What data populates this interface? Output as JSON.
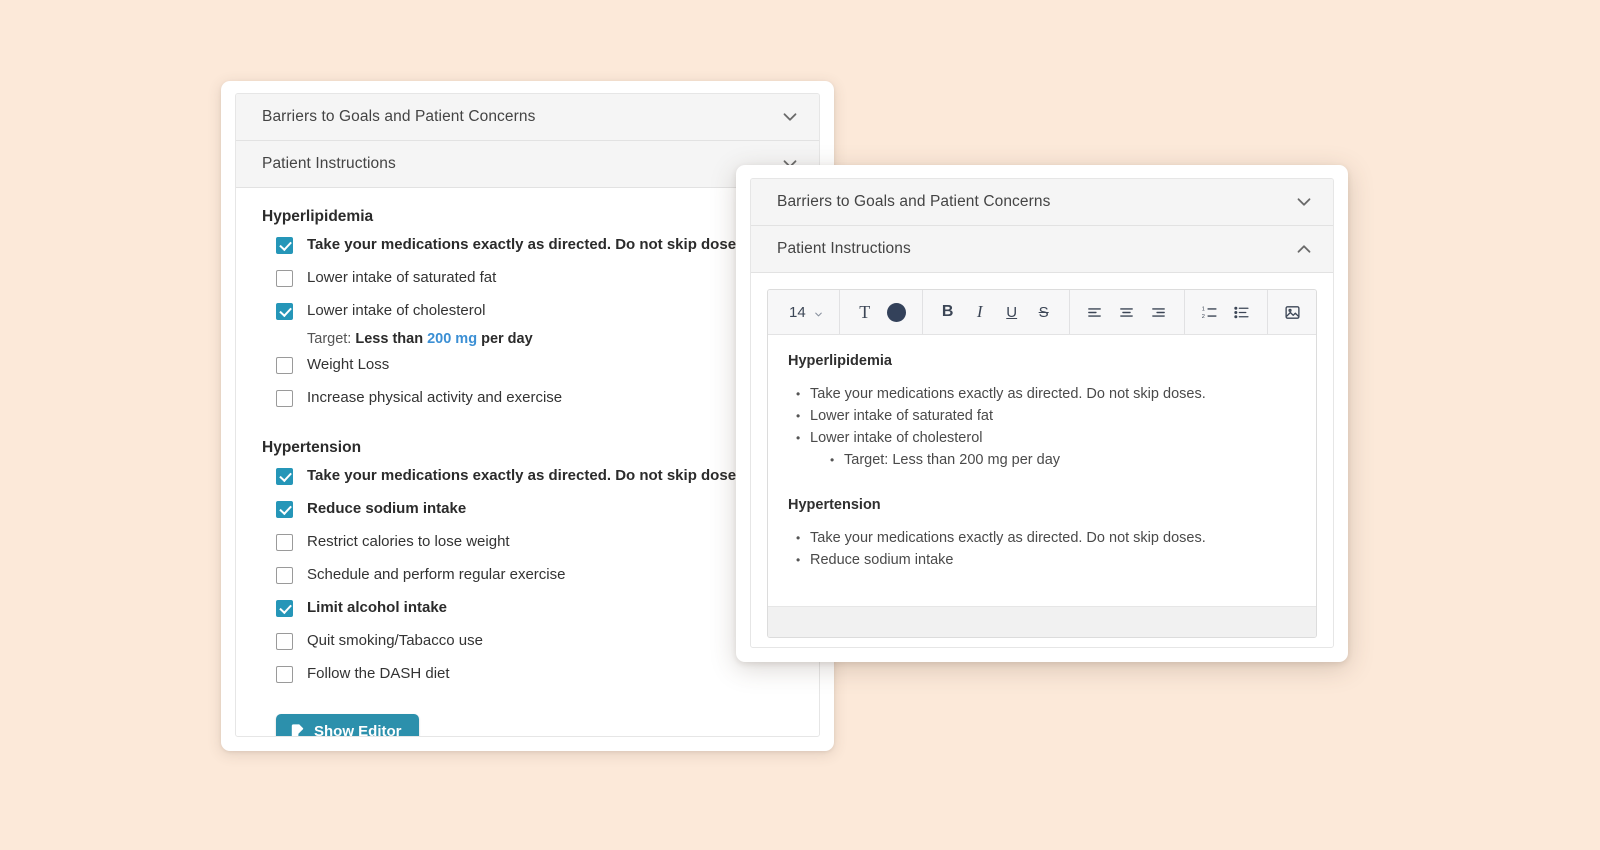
{
  "theme": {
    "page_background": "#fce9d9",
    "accent_teal": "#2596b8",
    "button_teal": "#2c90ac",
    "highlight_blue": "#3b8fd4",
    "toolbar_swatch": "#33415a",
    "header_gray": "#f5f5f5"
  },
  "background_panel": {
    "accordions": [
      {
        "title": "Barriers to Goals and Patient Concerns",
        "state": "collapsed",
        "icon": "chevron-down-icon"
      },
      {
        "title": "Patient Instructions",
        "state": "expanded",
        "icon": "chevron-down-icon"
      }
    ],
    "sections": [
      {
        "title": "Hyperlipidemia",
        "items": [
          {
            "label": "Take your medications exactly as directed. Do not skip doses.",
            "checked": true
          },
          {
            "label": "Lower intake of saturated fat",
            "checked": false
          },
          {
            "label": "Lower intake of cholesterol",
            "checked": true,
            "note": {
              "lead": "Target: ",
              "bold_before": "Less than ",
              "highlight": "200 mg",
              "bold_after": " per day"
            }
          },
          {
            "label": "Weight Loss",
            "checked": false
          },
          {
            "label": "Increase physical activity and exercise",
            "checked": false
          }
        ]
      },
      {
        "title": "Hypertension",
        "items": [
          {
            "label": "Take your medications exactly as directed. Do not skip doses.",
            "checked": true
          },
          {
            "label": "Reduce sodium intake",
            "checked": true
          },
          {
            "label": "Restrict calories to lose weight",
            "checked": false
          },
          {
            "label": "Schedule and perform regular exercise",
            "checked": false
          },
          {
            "label": "Limit alcohol intake",
            "checked": true
          },
          {
            "label": "Quit smoking/Tabacco use",
            "checked": false
          },
          {
            "label": "Follow the DASH diet",
            "checked": false
          }
        ]
      }
    ],
    "show_editor_button": {
      "label": "Show Editor",
      "icon": "document-edit-icon"
    }
  },
  "modal": {
    "accordions": [
      {
        "title": "Barriers to Goals and Patient Concerns",
        "state": "collapsed",
        "icon": "chevron-down-icon"
      },
      {
        "title": "Patient Instructions",
        "state": "expanded",
        "icon": "chevron-up-icon"
      }
    ],
    "toolbar": {
      "font_size": {
        "value": "14",
        "icon": "chevron-down-icon"
      },
      "buttons": [
        {
          "name": "text-format",
          "glyph": "T",
          "icon": "text-format-icon"
        },
        {
          "name": "text-color",
          "glyph": "",
          "icon": "color-swatch-icon",
          "color": "#33415a"
        },
        {
          "name": "bold",
          "glyph": "B",
          "icon": "bold-icon"
        },
        {
          "name": "italic",
          "glyph": "I",
          "icon": "italic-icon"
        },
        {
          "name": "underline",
          "glyph": "U",
          "icon": "underline-icon"
        },
        {
          "name": "strikethrough",
          "glyph": "S",
          "icon": "strikethrough-icon"
        },
        {
          "name": "align-left",
          "glyph": "",
          "icon": "align-left-icon"
        },
        {
          "name": "align-center",
          "glyph": "",
          "icon": "align-center-icon"
        },
        {
          "name": "align-right",
          "glyph": "",
          "icon": "align-right-icon"
        },
        {
          "name": "ordered-list",
          "glyph": "",
          "icon": "ordered-list-icon"
        },
        {
          "name": "bullet-list",
          "glyph": "",
          "icon": "bullet-list-icon"
        },
        {
          "name": "insert-image",
          "glyph": "",
          "icon": "image-icon"
        },
        {
          "name": "insert-link",
          "glyph": "",
          "icon": "link-icon"
        }
      ]
    },
    "document": {
      "blocks": [
        {
          "heading": "Hyperlipidemia",
          "items": [
            {
              "text": "Take your medications exactly as directed. Do not skip doses.",
              "level": 1
            },
            {
              "text": "Lower intake of saturated fat",
              "level": 1
            },
            {
              "text": "Lower intake of cholesterol",
              "level": 1
            },
            {
              "text": "Target: Less than 200 mg per day",
              "level": 2
            }
          ]
        },
        {
          "heading": "Hypertension",
          "items": [
            {
              "text": "Take your medications exactly as directed. Do not skip doses.",
              "level": 1
            },
            {
              "text": "Reduce sodium intake",
              "level": 1
            }
          ]
        }
      ]
    }
  }
}
